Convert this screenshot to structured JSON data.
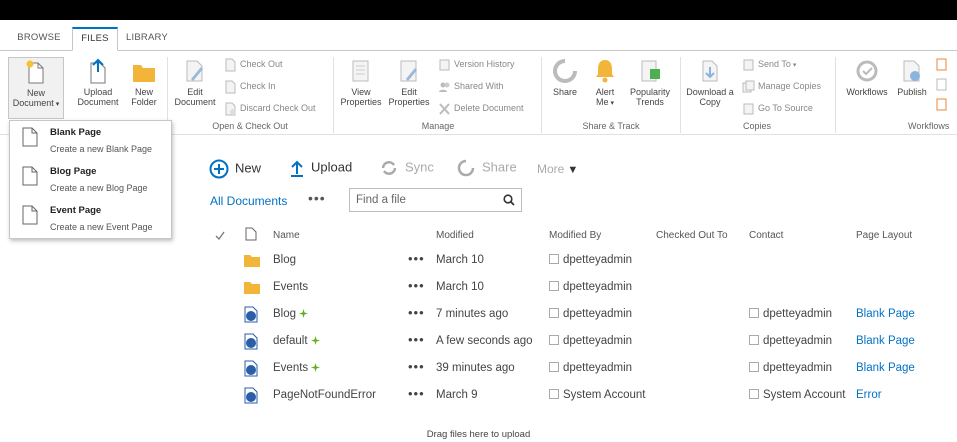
{
  "ribbon": {
    "tabs": [
      {
        "label": "BROWSE",
        "active": false
      },
      {
        "label": "FILES",
        "active": true
      },
      {
        "label": "LIBRARY",
        "active": false
      }
    ],
    "new_group": {
      "new_document": [
        "New",
        "Document"
      ],
      "upload_document": [
        "Upload",
        "Document"
      ],
      "new_folder": [
        "New",
        "Folder"
      ]
    },
    "open_checkout": {
      "edit_document": [
        "Edit",
        "Document"
      ],
      "check_out": "Check Out",
      "check_in": "Check In",
      "discard_check_out": "Discard Check Out",
      "label": "Open & Check Out"
    },
    "manage": {
      "view_properties": [
        "View",
        "Properties"
      ],
      "edit_properties": [
        "Edit",
        "Properties"
      ],
      "version_history": "Version History",
      "shared_with": "Shared With",
      "delete_document": "Delete Document",
      "label": "Manage"
    },
    "share_track": {
      "share": "Share",
      "alert_me": [
        "Alert",
        "Me"
      ],
      "popularity_trends": [
        "Popularity",
        "Trends"
      ],
      "label": "Share & Track"
    },
    "copies": {
      "download_copy": [
        "Download a",
        "Copy"
      ],
      "send_to": "Send To",
      "manage_copies": "Manage Copies",
      "go_to_source": "Go To Source",
      "label": "Copies"
    },
    "workflows": {
      "workflows": "Workflows",
      "publish": "Publish",
      "label": "Workflows"
    }
  },
  "new_document_menu": [
    {
      "title": "Blank Page",
      "description": "Create a new Blank Page"
    },
    {
      "title": "Blog Page",
      "description": "Create a new Blog Page"
    },
    {
      "title": "Event Page",
      "description": "Create a new Event Page"
    }
  ],
  "command_bar": {
    "new": "New",
    "upload": "Upload",
    "sync": "Sync",
    "share": "Share",
    "more": "More"
  },
  "view": {
    "label": "All Documents",
    "ellipsis": "•••",
    "search_placeholder": "Find a file"
  },
  "table": {
    "headers": {
      "name": "Name",
      "modified": "Modified",
      "modified_by": "Modified By",
      "checked_out_to": "Checked Out To",
      "contact": "Contact",
      "page_layout": "Page Layout"
    },
    "rows": [
      {
        "type": "folder",
        "name": "Blog",
        "is_new": false,
        "dots": "•••",
        "modified": "March 10",
        "modified_by": "dpetteyadmin",
        "contact": "",
        "page_layout": ""
      },
      {
        "type": "folder",
        "name": "Events",
        "is_new": false,
        "dots": "•••",
        "modified": "March 10",
        "modified_by": "dpetteyadmin",
        "contact": "",
        "page_layout": ""
      },
      {
        "type": "page",
        "name": "Blog",
        "is_new": true,
        "dots": "•••",
        "modified": "7 minutes ago",
        "modified_by": "dpetteyadmin",
        "contact": "dpetteyadmin",
        "page_layout": "Blank Page"
      },
      {
        "type": "page",
        "name": "default",
        "is_new": true,
        "dots": "•••",
        "modified": "A few seconds ago",
        "modified_by": "dpetteyadmin",
        "contact": "dpetteyadmin",
        "page_layout": "Blank Page"
      },
      {
        "type": "page",
        "name": "Events",
        "is_new": true,
        "dots": "•••",
        "modified": "39 minutes ago",
        "modified_by": "dpetteyadmin",
        "contact": "dpetteyadmin",
        "page_layout": "Blank Page"
      },
      {
        "type": "page",
        "name": "PageNotFoundError",
        "is_new": false,
        "dots": "•••",
        "modified": "March 9",
        "modified_by": "System Account",
        "contact": "System Account",
        "page_layout": "Error"
      }
    ]
  },
  "footer": {
    "drag_text": "Drag files here to upload"
  },
  "colors": {
    "accent": "#0072c6",
    "folder": "#f2b53a",
    "new_badge": "#5fb01f"
  }
}
